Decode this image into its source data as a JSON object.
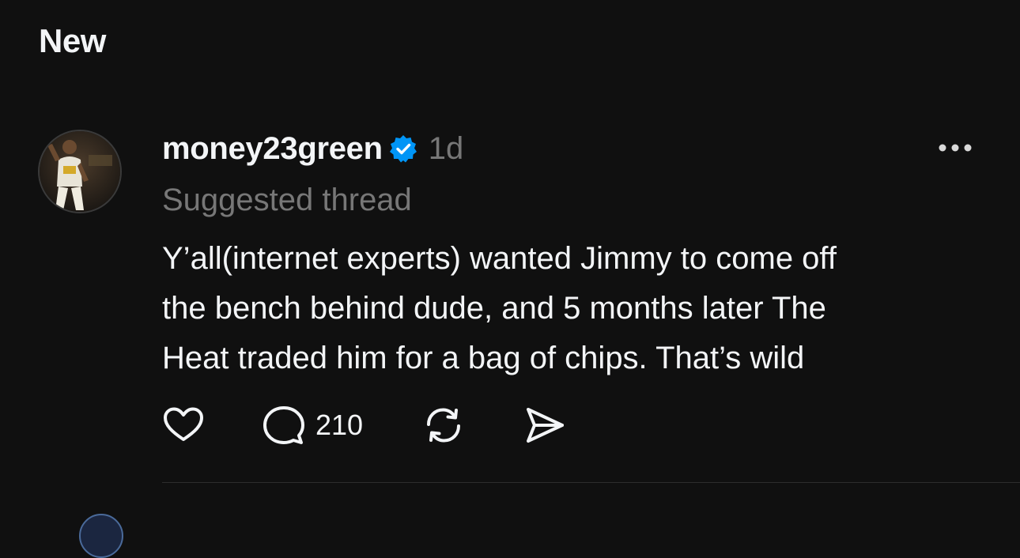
{
  "feed": {
    "section_title": "New"
  },
  "post": {
    "avatar_icon": "user-avatar-basketball-player",
    "username": "money23green",
    "verified_icon": "verified-badge-icon",
    "verified_color": "#0095f6",
    "timestamp": "1d",
    "subtitle": "Suggested thread",
    "body_lines": [
      "Y’all(internet experts)  wanted Jimmy to come off",
      "the bench behind dude, and 5 months later The",
      "Heat traded him for a bag of chips. That’s wild"
    ],
    "more_icon": "more-horizontal-icon",
    "actions": {
      "like_icon": "heart-icon",
      "reply_icon": "comment-icon",
      "reply_count": "210",
      "repost_icon": "repost-icon",
      "share_icon": "send-icon"
    }
  },
  "colors": {
    "background": "#101010",
    "primary_text": "#f3f5f7",
    "secondary_text": "#777777",
    "divider": "#2d2d2d"
  }
}
